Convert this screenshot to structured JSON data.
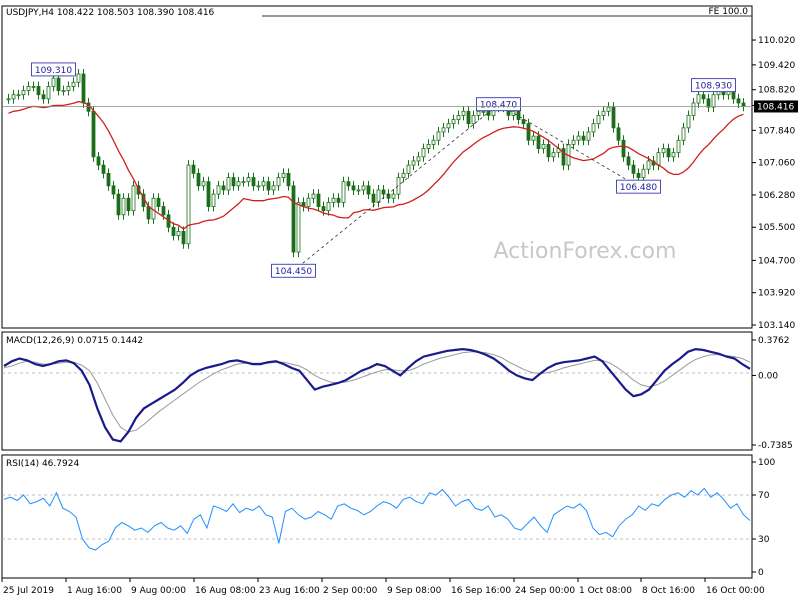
{
  "chart_data": [
    {
      "type": "candlestick",
      "panel": "price",
      "symbol_label": "USDJPY,H4  108.422 108.503 108.390 108.416",
      "fe_label": "FE 100.0",
      "watermark": "ActionForex.com",
      "ylim": [
        103.14,
        110.6
      ],
      "y_ticks": [
        "110.020",
        "109.420",
        "108.820",
        "108.440",
        "107.840",
        "107.060",
        "106.280",
        "105.500",
        "104.700",
        "103.920",
        "103.140"
      ],
      "current_price": "108.416",
      "annotations": [
        {
          "label": "109.310",
          "value": 109.31
        },
        {
          "label": "104.450",
          "value": 104.45
        },
        {
          "label": "108.470",
          "value": 108.47
        },
        {
          "label": "106.480",
          "value": 106.48
        },
        {
          "label": "108.930",
          "value": 108.93
        }
      ],
      "close_series": [
        108.6,
        108.7,
        108.7,
        108.8,
        108.9,
        108.9,
        108.7,
        108.6,
        108.9,
        109.1,
        108.8,
        108.8,
        108.9,
        109.0,
        109.2,
        108.5,
        108.3,
        107.2,
        107.0,
        106.8,
        106.5,
        106.3,
        105.8,
        106.2,
        105.9,
        106.5,
        106.3,
        106.0,
        105.7,
        106.2,
        106.0,
        105.8,
        105.5,
        105.3,
        105.4,
        105.1,
        107.0,
        106.8,
        106.5,
        106.6,
        106.0,
        106.3,
        106.5,
        106.4,
        106.7,
        106.5,
        106.6,
        106.6,
        106.7,
        106.5,
        106.5,
        106.6,
        106.4,
        106.5,
        106.7,
        106.8,
        106.5,
        104.9,
        106.1,
        106.0,
        106.2,
        106.3,
        106.0,
        105.9,
        106.1,
        106.2,
        106.1,
        106.6,
        106.5,
        106.4,
        106.4,
        106.5,
        106.3,
        106.1,
        106.4,
        106.3,
        106.2,
        106.3,
        106.7,
        106.8,
        107.0,
        107.1,
        107.2,
        107.4,
        107.5,
        107.6,
        107.8,
        107.9,
        108.0,
        108.1,
        108.2,
        108.3,
        108.0,
        108.2,
        108.3,
        108.3,
        108.2,
        108.4,
        108.5,
        108.4,
        108.2,
        108.3,
        108.1,
        108.0,
        107.6,
        107.7,
        107.4,
        107.5,
        107.2,
        107.3,
        107.4,
        107.0,
        107.5,
        107.6,
        107.7,
        107.6,
        107.8,
        108.0,
        108.2,
        108.3,
        108.4,
        107.9,
        107.6,
        107.2,
        107.0,
        106.8,
        106.7,
        106.9,
        107.1,
        107.0,
        107.3,
        107.4,
        107.2,
        107.3,
        107.6,
        107.9,
        108.2,
        108.5,
        108.7,
        108.6,
        108.4,
        108.7,
        108.8,
        108.7,
        108.8,
        108.6,
        108.5,
        108.42
      ],
      "ma_color": "#d21e1e",
      "candle_color": "#1b6f1b"
    },
    {
      "type": "line",
      "panel": "macd",
      "label": "MACD(12,26,9) 0.0715 0.1442",
      "ylim": [
        -0.7385,
        0.3762
      ],
      "y_ticks": [
        "0.3762",
        "0.00",
        "-0.7385"
      ],
      "series": [
        {
          "values": [
            0.1,
            0.15,
            0.18,
            0.16,
            0.12,
            0.1,
            0.12,
            0.15,
            0.16,
            0.13,
            0.05,
            -0.1,
            -0.35,
            -0.55,
            -0.68,
            -0.7,
            -0.6,
            -0.45,
            -0.35,
            -0.3,
            -0.25,
            -0.2,
            -0.15,
            -0.08,
            0.0,
            0.05,
            0.08,
            0.1,
            0.12,
            0.15,
            0.16,
            0.14,
            0.12,
            0.12,
            0.14,
            0.15,
            0.12,
            0.08,
            0.05,
            -0.05,
            -0.15,
            -0.12,
            -0.1,
            -0.08,
            -0.05,
            0.0,
            0.05,
            0.08,
            0.12,
            0.1,
            0.05,
            0.0,
            0.08,
            0.15,
            0.2,
            0.22,
            0.24,
            0.26,
            0.27,
            0.28,
            0.27,
            0.25,
            0.22,
            0.18,
            0.12,
            0.05,
            0.0,
            -0.03,
            -0.05,
            0.02,
            0.08,
            0.12,
            0.14,
            0.15,
            0.16,
            0.18,
            0.2,
            0.15,
            0.05,
            -0.05,
            -0.15,
            -0.22,
            -0.2,
            -0.15,
            -0.05,
            0.05,
            0.12,
            0.18,
            0.25,
            0.28,
            0.27,
            0.25,
            0.23,
            0.2,
            0.18,
            0.12,
            0.07
          ],
          "color": "#1a1a8c"
        },
        {
          "values": [
            0.08,
            0.1,
            0.13,
            0.15,
            0.14,
            0.12,
            0.12,
            0.13,
            0.14,
            0.14,
            0.11,
            0.05,
            -0.08,
            -0.25,
            -0.42,
            -0.55,
            -0.6,
            -0.58,
            -0.52,
            -0.45,
            -0.38,
            -0.32,
            -0.26,
            -0.2,
            -0.14,
            -0.08,
            -0.03,
            0.02,
            0.06,
            0.09,
            0.12,
            0.13,
            0.13,
            0.13,
            0.13,
            0.14,
            0.14,
            0.12,
            0.1,
            0.06,
            0.0,
            -0.04,
            -0.07,
            -0.08,
            -0.07,
            -0.05,
            -0.02,
            0.01,
            0.04,
            0.06,
            0.06,
            0.05,
            0.05,
            0.08,
            0.12,
            0.15,
            0.18,
            0.2,
            0.22,
            0.24,
            0.25,
            0.25,
            0.24,
            0.22,
            0.19,
            0.14,
            0.1,
            0.06,
            0.03,
            0.02,
            0.03,
            0.05,
            0.08,
            0.1,
            0.12,
            0.14,
            0.16,
            0.16,
            0.13,
            0.08,
            0.02,
            -0.05,
            -0.1,
            -0.12,
            -0.1,
            -0.06,
            0.0,
            0.06,
            0.12,
            0.17,
            0.2,
            0.22,
            0.22,
            0.21,
            0.2,
            0.18,
            0.14
          ],
          "color": "#999999"
        }
      ]
    },
    {
      "type": "line",
      "panel": "rsi",
      "label": "RSI(14) 46.7924",
      "ylim": [
        0,
        100
      ],
      "y_ticks": [
        "100",
        "70",
        "30",
        "0"
      ],
      "levels": [
        70,
        30
      ],
      "series": [
        {
          "values": [
            66,
            68,
            65,
            70,
            62,
            64,
            67,
            60,
            72,
            58,
            55,
            50,
            30,
            22,
            20,
            25,
            28,
            40,
            45,
            42,
            38,
            40,
            36,
            42,
            45,
            40,
            38,
            42,
            35,
            48,
            52,
            40,
            60,
            58,
            55,
            62,
            54,
            58,
            56,
            60,
            52,
            50,
            26,
            55,
            58,
            52,
            48,
            50,
            55,
            52,
            48,
            60,
            62,
            58,
            56,
            52,
            55,
            60,
            64,
            62,
            58,
            66,
            68,
            64,
            62,
            72,
            70,
            75,
            68,
            60,
            64,
            66,
            58,
            56,
            60,
            50,
            52,
            48,
            40,
            38,
            44,
            50,
            42,
            36,
            52,
            56,
            60,
            58,
            62,
            56,
            40,
            34,
            36,
            32,
            42,
            48,
            52,
            60,
            56,
            62,
            60,
            66,
            70,
            72,
            68,
            74,
            70,
            76,
            68,
            72,
            66,
            58,
            62,
            52,
            46.8
          ],
          "color": "#1e90ff"
        }
      ]
    }
  ],
  "x_labels": [
    "25 Jul 2019",
    "1 Aug 16:00",
    "9 Aug 00:00",
    "16 Aug 08:00",
    "23 Aug 16:00",
    "2 Sep 00:00",
    "9 Sep 08:00",
    "16 Sep 16:00",
    "24 Sep 00:00",
    "1 Oct 08:00",
    "8 Oct 16:00",
    "16 Oct 00:00"
  ]
}
